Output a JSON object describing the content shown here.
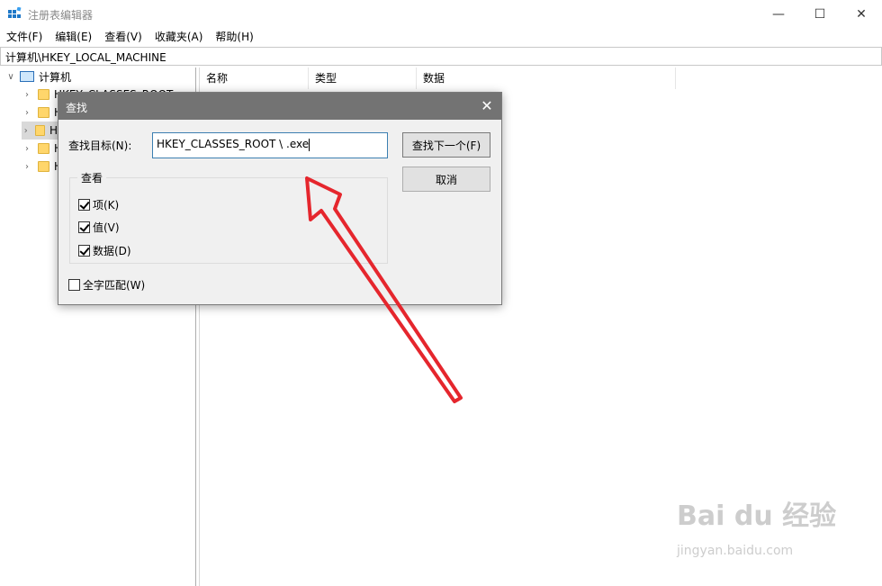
{
  "window": {
    "title": "注册表编辑器"
  },
  "menu": [
    "文件(F)",
    "编辑(E)",
    "查看(V)",
    "收藏夹(A)",
    "帮助(H)"
  ],
  "address": "计算机\\HKEY_LOCAL_MACHINE",
  "tree": {
    "root": "计算机",
    "items": [
      "HKEY_CLASSES_ROOT",
      "H",
      "H",
      "H",
      "H"
    ]
  },
  "list": {
    "columns": [
      "名称",
      "类型",
      "数据"
    ]
  },
  "dialog": {
    "title": "查找",
    "target_label": "查找目标(N):",
    "target_value": "HKEY_CLASSES_ROOT \\ .exe",
    "find_next": "查找下一个(F)",
    "cancel": "取消",
    "look_at": "查看",
    "options": [
      {
        "label": "项(K)",
        "checked": true
      },
      {
        "label": "值(V)",
        "checked": true
      },
      {
        "label": "数据(D)",
        "checked": true
      }
    ],
    "match_whole": {
      "label": "全字匹配(W)",
      "checked": false
    }
  },
  "watermark": {
    "main": "Bai du 经验",
    "sub": "jingyan.baidu.com"
  },
  "colors": {
    "annotation_arrow": "#e5262d",
    "dialog_title_bg": "#737373"
  }
}
